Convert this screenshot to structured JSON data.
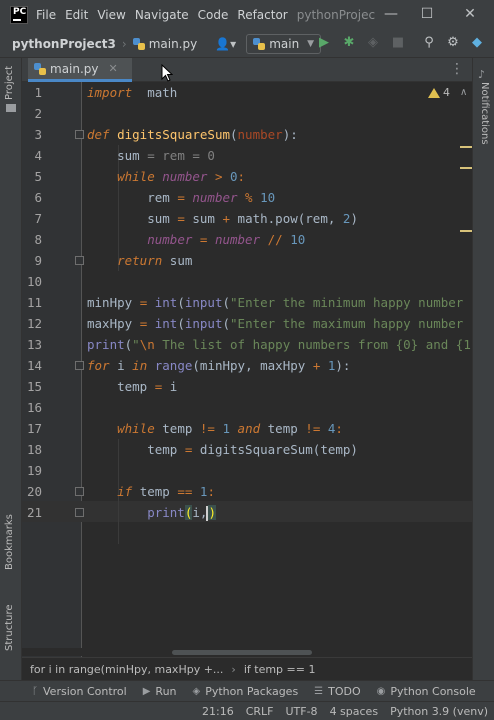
{
  "menu": {
    "items": [
      "File",
      "Edit",
      "View",
      "Navigate",
      "Code",
      "Refactor"
    ],
    "title": "pythonProjec"
  },
  "toolbar": {
    "project": "pythonProject3",
    "file": "main.py",
    "branch": "main"
  },
  "tabs": [
    {
      "label": "main.py"
    }
  ],
  "side": {
    "project": "Project",
    "bookmarks": "Bookmarks",
    "structure": "Structure",
    "notifications": "Notifications"
  },
  "inspection": {
    "count": "4"
  },
  "editor": {
    "lines": [
      {
        "n": "1",
        "spans": [
          [
            "kwi",
            "import"
          ],
          [
            "",
            "  math"
          ]
        ]
      },
      {
        "n": "2",
        "spans": []
      },
      {
        "n": "3",
        "spans": [
          [
            "kwi",
            "def "
          ],
          [
            "fn",
            "digitsSquareSum"
          ],
          [
            "",
            "("
          ],
          [
            "par",
            "number"
          ],
          [
            "",
            "):"
          ]
        ]
      },
      {
        "n": "4",
        "spans": [
          [
            "",
            "    sum "
          ],
          [
            "grey",
            "= rem = 0"
          ]
        ]
      },
      {
        "n": "5",
        "spans": [
          [
            "kwi",
            "    while "
          ],
          [
            "parit",
            "number"
          ],
          [
            "kw",
            " > "
          ],
          [
            "num",
            "0"
          ],
          [
            "kw",
            ":"
          ]
        ]
      },
      {
        "n": "6",
        "spans": [
          [
            "",
            "        rem "
          ],
          [
            "kw",
            "= "
          ],
          [
            "parit",
            "number"
          ],
          [
            "kw",
            " % "
          ],
          [
            "num",
            "10"
          ]
        ]
      },
      {
        "n": "7",
        "spans": [
          [
            "",
            "        sum "
          ],
          [
            "kw",
            "= "
          ],
          [
            "",
            "sum "
          ],
          [
            "kw",
            "+ "
          ],
          [
            "",
            "math.pow(rem, "
          ],
          [
            "num",
            "2"
          ],
          [
            "",
            ")"
          ]
        ]
      },
      {
        "n": "8",
        "spans": [
          [
            "",
            "        "
          ],
          [
            "parit",
            "number"
          ],
          [
            "kw",
            " = "
          ],
          [
            "parit",
            "number"
          ],
          [
            "kw",
            " // "
          ],
          [
            "num",
            "10"
          ]
        ]
      },
      {
        "n": "9",
        "spans": [
          [
            "kwi",
            "    return "
          ],
          [
            "",
            "sum"
          ]
        ]
      },
      {
        "n": "10",
        "spans": []
      },
      {
        "n": "11",
        "spans": [
          [
            "",
            "minHpy "
          ],
          [
            "kw",
            "= "
          ],
          [
            "blt",
            "int"
          ],
          [
            "",
            "("
          ],
          [
            "blt",
            "input"
          ],
          [
            "",
            "("
          ],
          [
            "str",
            "\"Enter the minimum happy number "
          ]
        ]
      },
      {
        "n": "12",
        "spans": [
          [
            "",
            "maxHpy "
          ],
          [
            "kw",
            "= "
          ],
          [
            "blt",
            "int"
          ],
          [
            "",
            "("
          ],
          [
            "blt",
            "input"
          ],
          [
            "",
            "("
          ],
          [
            "str",
            "\"Enter the maximum happy number "
          ]
        ]
      },
      {
        "n": "13",
        "spans": [
          [
            "blt",
            "print"
          ],
          [
            "",
            "("
          ],
          [
            "str",
            "\""
          ],
          [
            "esc",
            "\\n"
          ],
          [
            "str",
            " The list of happy numbers from {0} and {1"
          ]
        ]
      },
      {
        "n": "14",
        "spans": [
          [
            "kwi",
            "for "
          ],
          [
            "",
            "i "
          ],
          [
            "kwi",
            "in "
          ],
          [
            "blt",
            "range"
          ],
          [
            "",
            "(minHpy, maxHpy "
          ],
          [
            "kw",
            "+ "
          ],
          [
            "num",
            "1"
          ],
          [
            "",
            "):"
          ]
        ]
      },
      {
        "n": "15",
        "spans": [
          [
            "",
            "    temp "
          ],
          [
            "kw",
            "= "
          ],
          [
            "",
            "i"
          ]
        ]
      },
      {
        "n": "16",
        "spans": []
      },
      {
        "n": "17",
        "spans": [
          [
            "kwi",
            "    while "
          ],
          [
            "",
            "temp "
          ],
          [
            "kw",
            "!= "
          ],
          [
            "num",
            "1 "
          ],
          [
            "kwi",
            "and "
          ],
          [
            "",
            "temp "
          ],
          [
            "kw",
            "!= "
          ],
          [
            "num",
            "4"
          ],
          [
            "kw",
            ":"
          ]
        ]
      },
      {
        "n": "18",
        "spans": [
          [
            "",
            "        temp "
          ],
          [
            "kw",
            "= "
          ],
          [
            "",
            "digitsSquareSum(temp)"
          ]
        ]
      },
      {
        "n": "19",
        "spans": []
      },
      {
        "n": "20",
        "spans": [
          [
            "kwi",
            "    if "
          ],
          [
            "",
            "temp "
          ],
          [
            "kw",
            "== "
          ],
          [
            "num",
            "1"
          ],
          [
            "kw",
            ":"
          ]
        ]
      },
      {
        "n": "21",
        "spans": [
          [
            "blt",
            "        print"
          ],
          [
            "bracket-hl",
            "("
          ],
          [
            "",
            "i,"
          ],
          [
            "caret",
            ""
          ],
          [
            "bracket-hl",
            ")"
          ]
        ]
      }
    ]
  },
  "breadcrumb": [
    "for i in range(minHpy, maxHpy +...",
    "if temp == 1"
  ],
  "toolwindows": [
    {
      "icon": "branch-icon",
      "label": "Version Control"
    },
    {
      "icon": "run-icon",
      "label": "Run"
    },
    {
      "icon": "layers-icon",
      "label": "Python Packages"
    },
    {
      "icon": "todo-icon",
      "label": "TODO"
    },
    {
      "icon": "console-icon",
      "label": "Python Console"
    }
  ],
  "status": {
    "position": "21:16",
    "line_sep": "CRLF",
    "encoding": "UTF-8",
    "indent": "4 spaces",
    "interpreter": "Python 3.9 (venv)"
  },
  "colors": {
    "accent": "#4a88c7",
    "keyword": "#cc7832",
    "function": "#ffc66d",
    "string": "#6a8759",
    "number": "#6897bb"
  }
}
